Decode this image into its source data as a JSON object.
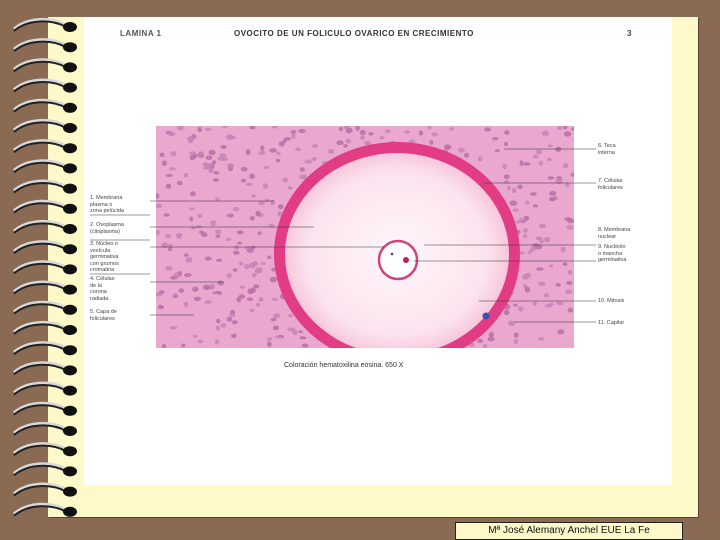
{
  "plate": {
    "label": "LAMINA 1",
    "title": "OVOCITO DE UN FOLICULO OVARICO EN CRECIMIENTO",
    "number": "3",
    "caption": "Coloración hematoxilina eosina. 650 X"
  },
  "labels_left": [
    "1. Membrana\nplasma o\nzona pelúcida",
    "2. Ovoplasma\n(citoplasma)",
    "3. Núcleo o\nvesícula\ngerminativa\ncon grumos\ncromatina",
    "4. Células\nde la\ncorona\nradiada",
    "5. Capa de\nfoliculares"
  ],
  "labels_right": [
    "6. Teca\ninterna",
    "7. Células\nfoliculares",
    "8. Membrana\nnuclear",
    "9. Nucléolo\no mancha\ngerminativa",
    "10. Mitosis",
    "11. Capilar"
  ],
  "footer": {
    "credit": "Mª José Alemany Anchel  EUE La Fe"
  },
  "colors": {
    "background": "#8a6a52",
    "notebook_paper": "#fdf9c8",
    "zona_pellucida": "#e23c85",
    "tissue": "#e9a6cd"
  }
}
